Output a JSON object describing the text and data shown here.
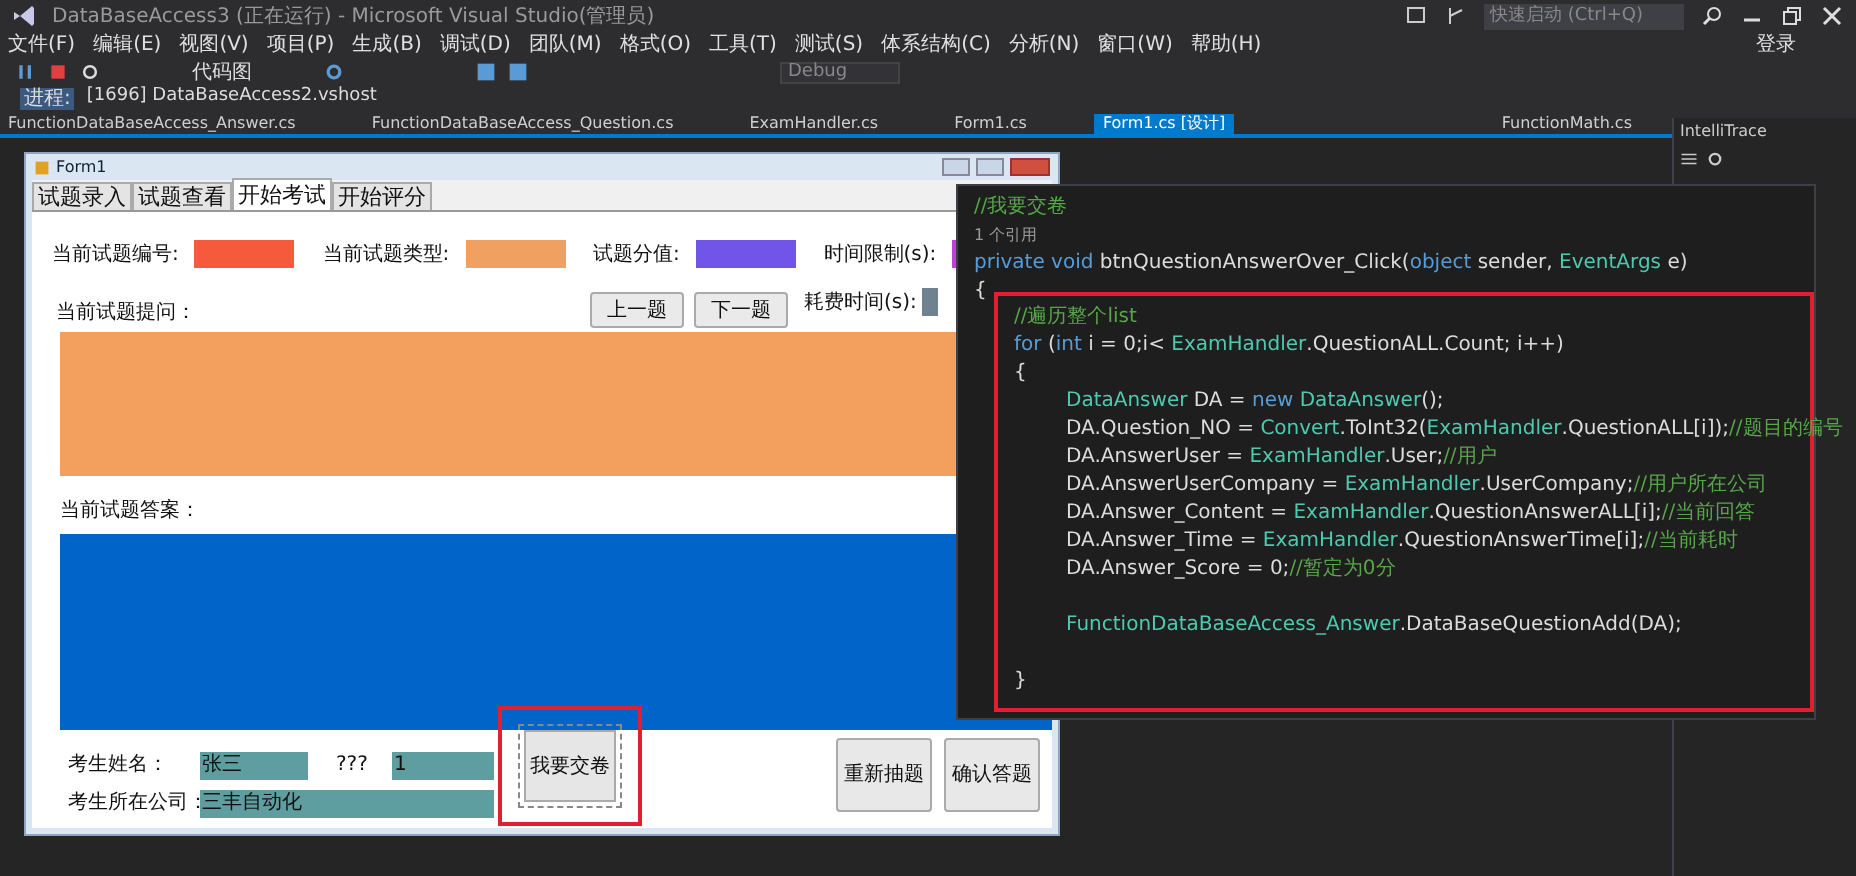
{
  "window": {
    "title": "DataBaseAccess3 (正在运行) - Microsoft Visual Studio(管理员)",
    "quick_launch": {
      "placeholder": "快速启动 (Ctrl+Q)"
    },
    "sign_in": "登录"
  },
  "menu": [
    "文件(F)",
    "编辑(E)",
    "视图(V)",
    "项目(P)",
    "生成(B)",
    "调试(D)",
    "团队(M)",
    "格式(O)",
    "工具(T)",
    "测试(S)",
    "体系结构(C)",
    "分析(N)",
    "窗口(W)",
    "帮助(H)"
  ],
  "toolbar": {
    "code_map": "代码图",
    "configuration": "Debug"
  },
  "process_bar": {
    "label": "进程:",
    "process": "[1696] DataBaseAccess2.vshost"
  },
  "doc_tabs": [
    {
      "label": "FunctionDataBaseAccess_Answer.cs",
      "selected": false
    },
    {
      "label": "FunctionDataBaseAccess_Question.cs",
      "selected": false
    },
    {
      "label": "ExamHandler.cs",
      "selected": false
    },
    {
      "label": "Form1.cs",
      "selected": false
    },
    {
      "label": "Form1.cs [设计]",
      "selected": true
    },
    {
      "label": "FunctionMath.cs",
      "selected": false
    }
  ],
  "intellitrace": {
    "title": "IntelliTrace"
  },
  "form": {
    "title": "Form1",
    "tabs": [
      {
        "label": "试题录入",
        "selected": false
      },
      {
        "label": "试题查看",
        "selected": false
      },
      {
        "label": "开始考试",
        "selected": true
      },
      {
        "label": "开始评分",
        "selected": false
      }
    ],
    "info_fields": [
      {
        "label": "当前试题编号:",
        "color": "#f55a3c"
      },
      {
        "label": "当前试题类型:",
        "color": "#f0a060"
      },
      {
        "label": "试题分值:",
        "color": "#7055e8"
      },
      {
        "label": "时间限制(s):",
        "color": "#c040d8"
      }
    ],
    "question_label": "当前试题提问：",
    "nav_buttons": [
      "上一题",
      "下一题"
    ],
    "elapsed": {
      "label": "耗费时间(s):",
      "color": "#6e8290"
    },
    "question_area": {
      "color": "#f3a05e"
    },
    "answer_label": "当前试题答案：",
    "answer_area": {
      "color": "#0064c8"
    },
    "name_label": "考生姓名：",
    "name_value": "张三",
    "unknown_label": "???",
    "number_value": "1",
    "company_label": "考生所在公司：",
    "company_value": "三丰自动化",
    "submit_button": "我要交卷",
    "action_buttons": [
      "重新抽题",
      "确认答题"
    ]
  },
  "code": {
    "header": [
      [
        {
          "text": "//我要交卷",
          "kind": "comment"
        }
      ],
      [
        {
          "text": "1 个引用",
          "kind": "ref"
        }
      ],
      [
        {
          "text": "private void ",
          "kind": "keyword"
        },
        {
          "text": "btnQuestionAnswerOver_Click(",
          "kind": "plain"
        },
        {
          "text": "object ",
          "kind": "keyword"
        },
        {
          "text": "sender, ",
          "kind": "plain"
        },
        {
          "text": "EventArgs ",
          "kind": "type"
        },
        {
          "text": "e)",
          "kind": "plain"
        }
      ],
      [
        {
          "text": "{",
          "kind": "plain"
        }
      ]
    ],
    "block": [
      {
        "kind": "code",
        "tokens": [
          {
            "text": "//遍历整个list",
            "kind": "comment"
          }
        ]
      },
      {
        "kind": "code",
        "tokens": [
          {
            "text": "for ",
            "kind": "keyword"
          },
          {
            "text": "(",
            "kind": "plain"
          },
          {
            "text": "int ",
            "kind": "keyword"
          },
          {
            "text": "i = 0;i< ",
            "kind": "plain"
          },
          {
            "text": "ExamHandler",
            "kind": "type"
          },
          {
            "text": ".QuestionALL.Count; i++)",
            "kind": "plain"
          }
        ]
      },
      {
        "kind": "code",
        "tokens": [
          {
            "text": "{",
            "kind": "plain"
          }
        ],
        "children": [
          {
            "kind": "code",
            "tokens": [
              {
                "text": "DataAnswer ",
                "kind": "type"
              },
              {
                "text": "DA = ",
                "kind": "plain"
              },
              {
                "text": "new ",
                "kind": "keyword"
              },
              {
                "text": "DataAnswer",
                "kind": "type"
              },
              {
                "text": "();",
                "kind": "plain"
              }
            ]
          },
          {
            "kind": "code",
            "tokens": [
              {
                "text": "DA.Question_NO = ",
                "kind": "plain"
              },
              {
                "text": "Convert",
                "kind": "type"
              },
              {
                "text": ".ToInt32(",
                "kind": "plain"
              },
              {
                "text": "ExamHandler",
                "kind": "type"
              },
              {
                "text": ".QuestionALL[i]);",
                "kind": "plain"
              },
              {
                "text": "//题目的编号",
                "kind": "comment"
              }
            ]
          },
          {
            "kind": "code",
            "tokens": [
              {
                "text": "DA.AnswerUser = ",
                "kind": "plain"
              },
              {
                "text": "ExamHandler",
                "kind": "type"
              },
              {
                "text": ".User;",
                "kind": "plain"
              },
              {
                "text": "//用户",
                "kind": "comment"
              }
            ]
          },
          {
            "kind": "code",
            "tokens": [
              {
                "text": "DA.AnswerUserCompany = ",
                "kind": "plain"
              },
              {
                "text": "ExamHandler",
                "kind": "type"
              },
              {
                "text": ".UserCompany;",
                "kind": "plain"
              },
              {
                "text": "//用户所在公司",
                "kind": "comment"
              }
            ]
          },
          {
            "kind": "code",
            "tokens": [
              {
                "text": "DA.Answer_Content = ",
                "kind": "plain"
              },
              {
                "text": "ExamHandler",
                "kind": "type"
              },
              {
                "text": ".QuestionAnswerALL[i];",
                "kind": "plain"
              },
              {
                "text": "//当前回答",
                "kind": "comment"
              }
            ]
          },
          {
            "kind": "code",
            "tokens": [
              {
                "text": "DA.Answer_Time = ",
                "kind": "plain"
              },
              {
                "text": "ExamHandler",
                "kind": "type"
              },
              {
                "text": ".QuestionAnswerTime[i];",
                "kind": "plain"
              },
              {
                "text": "//当前耗时",
                "kind": "comment"
              }
            ]
          },
          {
            "kind": "code",
            "tokens": [
              {
                "text": "DA.Answer_Score = 0;",
                "kind": "plain"
              },
              {
                "text": "//暂定为0分",
                "kind": "comment"
              }
            ]
          },
          {
            "kind": "blank"
          },
          {
            "kind": "code",
            "tokens": [
              {
                "text": "FunctionDataBaseAccess_Answer",
                "kind": "type"
              },
              {
                "text": ".DataBaseQuestionAdd(DA);",
                "kind": "plain"
              }
            ]
          }
        ]
      },
      {
        "kind": "blank"
      },
      {
        "kind": "code",
        "tokens": [
          {
            "text": "}",
            "kind": "plain"
          }
        ]
      }
    ]
  }
}
